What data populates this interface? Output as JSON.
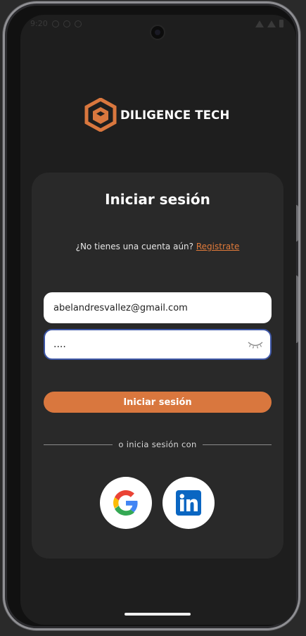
{
  "status_bar": {
    "time": "9:20"
  },
  "brand": {
    "name": "DILIGENCE TECH",
    "logo_color": "#d9773e"
  },
  "login_card": {
    "title": "Iniciar sesión",
    "register_prompt": "¿No tienes una cuenta aún?",
    "register_link": "Registrate",
    "email_value": "abelandresvallez@gmail.com",
    "password_value": "....",
    "submit_label": "Iniciar sesión",
    "divider_text": "o inicia sesión con"
  },
  "social": {
    "google_icon": "google-icon",
    "linkedin_icon": "linkedin-icon"
  },
  "colors": {
    "accent": "#d9773e",
    "card_bg": "#292929",
    "screen_bg": "#1e1e1e",
    "focus_border": "#3d56a6"
  }
}
